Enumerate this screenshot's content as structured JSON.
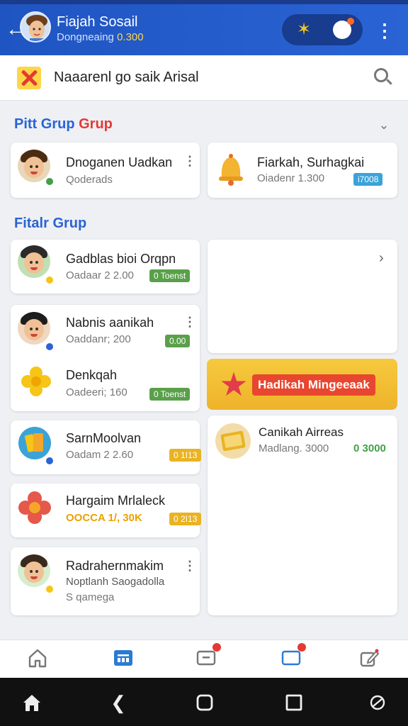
{
  "header": {
    "title": "Fiajah Sosail",
    "subtitle": "Dongneaing",
    "subtitle_coin": "0.300"
  },
  "search": {
    "text": "Naaarenl go saik Arisal"
  },
  "sections": {
    "pinned_title_a": "Pitt Grup",
    "pinned_title_b": "Grup",
    "featured_title": "Fitalr Grup"
  },
  "pinned": [
    {
      "name": "Dnoganen Uadkan",
      "meta": "Qoderads"
    },
    {
      "name": "Fiarkah, Surhagkai",
      "meta": "Oiadenr 1.300",
      "tag": "i7008"
    }
  ],
  "groups": [
    {
      "name": "Gadblas bioi Orqpn",
      "meta": "Oadaar 2 2.00",
      "tag": "0 Toenst"
    },
    {
      "name": "Nabnis aanikah",
      "meta": "Oaddanr; 200",
      "tag": "0.00"
    },
    {
      "name": "Denkqah",
      "meta": "Oadeeri; 160",
      "tag": "0 Toenst"
    },
    {
      "name": "SarnMoolvan",
      "meta": "Oadam 2 2.60",
      "tag": "0 1I13"
    },
    {
      "name": "Hargaim Mrlaleck",
      "meta": "OOCCA 1/, 30K",
      "tag": "0 2I13"
    },
    {
      "name": "Radrahernmakim",
      "meta": "Noptlanh Saogadolla",
      "meta2": "S qamega"
    }
  ],
  "banner": {
    "label": "Hadikah Mingeeaak"
  },
  "side_item": {
    "name": "Canikah Airreas",
    "meta": "Madlang. 3000",
    "value": "0 3000"
  },
  "colors": {
    "primary": "#2a63d4",
    "accent_red": "#e53935",
    "tag_green": "#5aa04a",
    "tag_yellow": "#e9b322",
    "tag_blue": "#3aa3d8"
  }
}
